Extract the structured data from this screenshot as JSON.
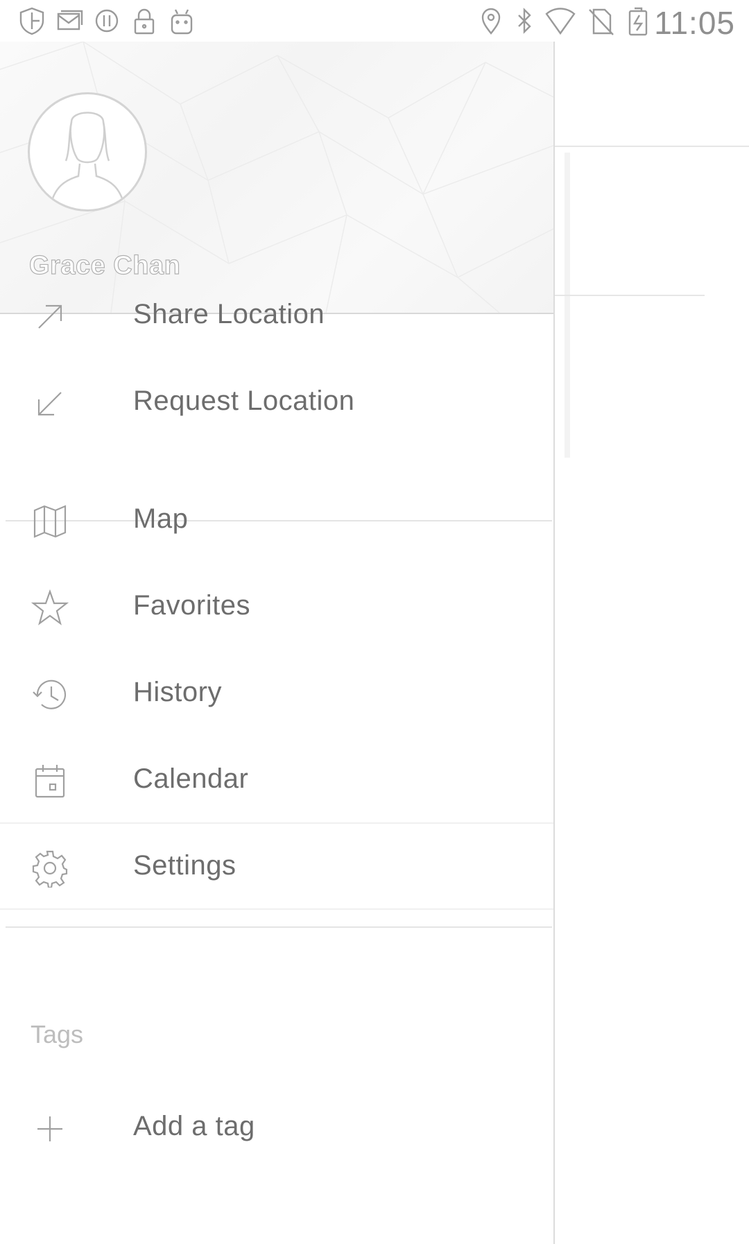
{
  "status_bar": {
    "time": "11:05",
    "left_icons": [
      "shield-icon",
      "message-icon",
      "sync-icon",
      "lock-icon",
      "android-icon"
    ],
    "right_icons": [
      "location-pin-icon",
      "bluetooth-icon",
      "wifi-icon",
      "no-sim-icon",
      "battery-charging-icon"
    ]
  },
  "drawer": {
    "header": {
      "user_name": "Grace Chan"
    },
    "menu": {
      "share_location": "Share Location",
      "request_location": "Request Location",
      "map": "Map",
      "favorites": "Favorites",
      "history": "History",
      "calendar": "Calendar",
      "settings": "Settings"
    },
    "tags": {
      "section_title": "Tags",
      "add_tag": "Add a tag"
    }
  },
  "colors": {
    "icon_gray": "#a0a0a0",
    "text_gray": "#6d6d6d",
    "divider": "#e4e4e4"
  }
}
